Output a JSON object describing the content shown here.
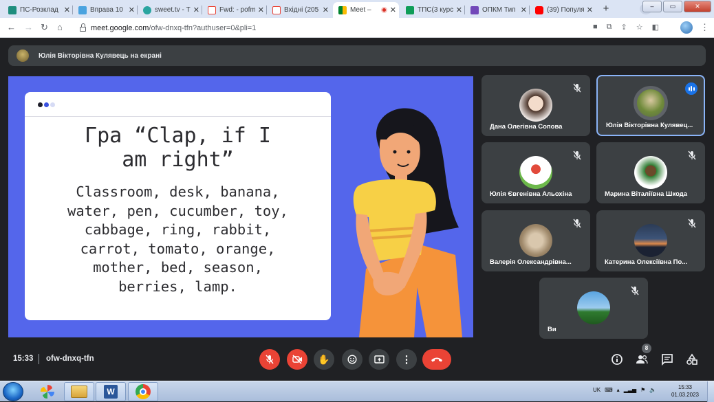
{
  "browser": {
    "tabs": [
      {
        "title": "ПС-Розклад",
        "fav_color": "#1e8e7e"
      },
      {
        "title": "Вправа 10",
        "fav_color": "#4aa3df"
      },
      {
        "title": "sweet.tv - Т",
        "fav_color": "#2aa5a0"
      },
      {
        "title": "Fwd: - pofm",
        "fav_color": "#ea4335"
      },
      {
        "title": "Вхідні (205",
        "fav_color": "#ea4335"
      },
      {
        "title": "Meet –",
        "fav_color": "#00832d",
        "active": true
      },
      {
        "title": "ТПС(3 курс",
        "fav_color": "#0f9d58"
      },
      {
        "title": "ОПКМ Тип",
        "fav_color": "#7248b9"
      },
      {
        "title": "(39) Популя",
        "fav_color": "#ff0000"
      }
    ],
    "url_host": "meet.google.com",
    "url_path": "/ofw-dnxq-tfn?authuser=0&pli=1"
  },
  "meet": {
    "presenting_banner": "Юлія Вікторівна Кулявець на екрані",
    "slide": {
      "title_line1": "Гра “Clap, if I",
      "title_line2": "am right”",
      "body_lines": [
        "Classroom, desk, banana,",
        "water, pen, cucumber, toy,",
        "cabbage, ring, rabbit,",
        "carrot, tomato, orange,",
        "mother, bed, season,",
        "berries, lamp."
      ]
    },
    "participants": [
      {
        "name": "Дана Олегівна Сопова",
        "muted": true
      },
      {
        "name": "Юлія Вікторівна Кулявец...",
        "muted": false,
        "speaking": true
      },
      {
        "name": "Юлія Євгенівна Альохіна",
        "muted": true
      },
      {
        "name": "Марина Віталіївна Шкода",
        "muted": true
      },
      {
        "name": "Валерія Олександрівна...",
        "muted": true
      },
      {
        "name": "Катерина Олексіївна По...",
        "muted": true
      },
      {
        "name": "Ви",
        "muted": true
      }
    ],
    "time": "15:33",
    "meeting_code": "ofw-dnxq-tfn",
    "people_count": "8",
    "colors": {
      "accent": "#8ab4f8",
      "danger": "#ea4335",
      "tile": "#3c4043",
      "slide_bg": "#5466eb"
    }
  },
  "taskbar": {
    "language": "UK",
    "time": "15:33",
    "date": "01.03.2023"
  }
}
